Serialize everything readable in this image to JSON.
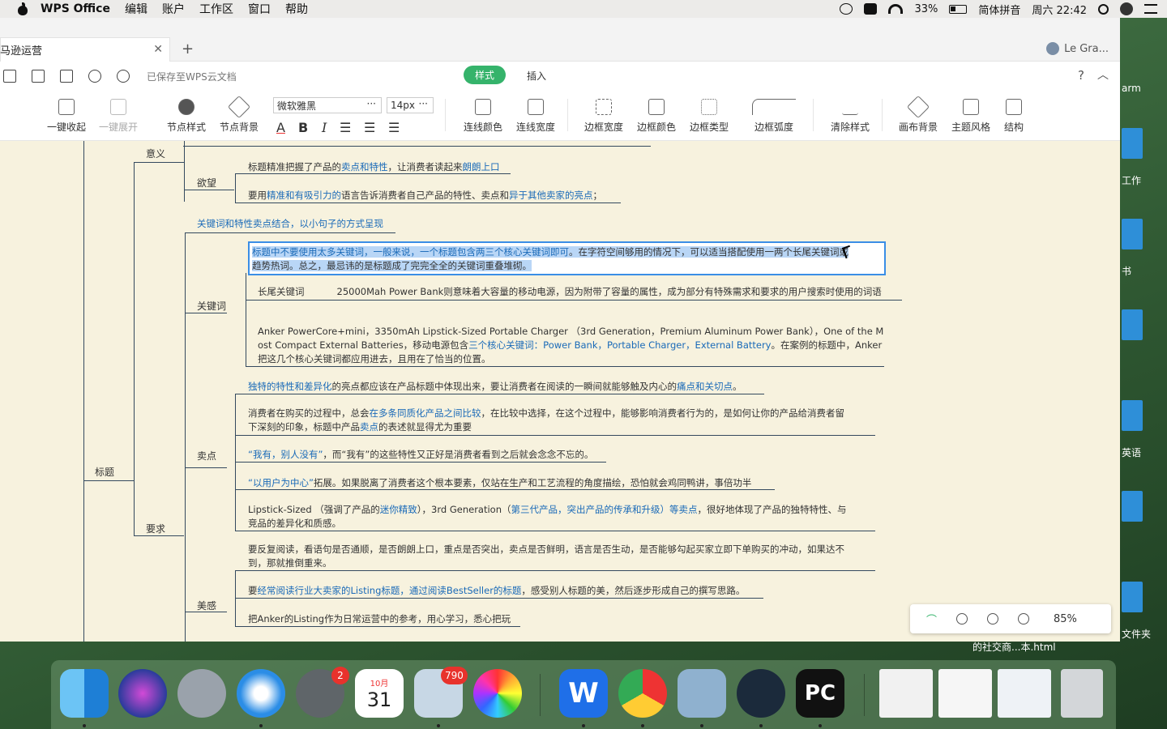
{
  "menubar": {
    "app": "WPS Office",
    "items": [
      "编辑",
      "账户",
      "工作区",
      "窗口",
      "帮助"
    ],
    "battery": "33%",
    "input_method": "简体拼音",
    "clock": "周六 22:42"
  },
  "tab": {
    "title": "亚马逊运营"
  },
  "user": {
    "name": "Le Gra..."
  },
  "toolbar": {
    "saved": "已保存至WPS云文档",
    "style_tab": "样式",
    "insert_tab": "插入",
    "help": "?",
    "buttons": {
      "collapse_all": "一键收起",
      "expand_all": "一键展开",
      "node_style": "节点样式",
      "node_bg": "节点背景",
      "line_color": "连线颜色",
      "line_width": "连线宽度",
      "border_width": "边框宽度",
      "border_color": "边框颜色",
      "border_type": "边框类型",
      "border_radius": "边框弧度",
      "clear_style": "清除样式",
      "canvas_bg": "画布背景",
      "theme": "主题风格",
      "structure": "结构"
    },
    "font": "微软雅黑",
    "font_size": "14px"
  },
  "mindmap": {
    "root": "标题",
    "b_meaning": "意义",
    "b_desire": "欲望",
    "desire_1_a": "标题精准把握了产品的",
    "desire_1_b": "卖点和特性",
    "desire_1_c": "，让消费者读起来",
    "desire_1_d": "朗朗上口",
    "desire_2_a": "要用",
    "desire_2_b": "精准和有吸引力的",
    "desire_2_c": "语言告诉消费者自己产品的特性、卖点和",
    "desire_2_d": "异于其他卖家的亮点",
    "desire_2_e": "；",
    "b_require": "要求",
    "kw_title": "关键词和特性卖点结合，以小句子的方式呈现",
    "b_keyword": "关键词",
    "kw_sel_1a": "标题中不要使用太多关键词，一般来说，一个标题包含两三个核心关键词即可",
    "kw_sel_1b": "。在字符空间够用的情况下，可以适当搭配使用一两个长尾关键词或",
    "kw_sel_2": "趋势热词。总之，最忌讳的是标题成了完完全全的关键词重叠堆砌。",
    "kw_longtail_label": "长尾关键词",
    "kw_longtail_text": "25000Mah Power Bank则意味着大容量的移动电源，因为附带了容量的属性，成为部分有特殊需求和要求的用户搜索时使用的词语",
    "kw_anker_1": "Anker PowerCore+mini，3350mAh Lipstick-Sized Portable Charger （3rd Generation，Premium Aluminum Power Bank），One of the M",
    "kw_anker_2a": "ost Compact External Batteries，移动电源包含",
    "kw_anker_2b": "三个核心关键词：Power Bank，Portable Charger，External Battery",
    "kw_anker_2c": "。在案例的标题中，Anker",
    "kw_anker_3": "把这几个核心关键词都应用进去，且用在了恰当的位置。",
    "b_selling": "卖点",
    "sp_title_a": "独特的特性和差异化",
    "sp_title_b": "的亮点都应该在产品标题中体现出来，要让消费者在阅读的一瞬间就能够触及内心的",
    "sp_title_c": "痛点和关切点",
    "sp_title_d": "。",
    "sp_1a": "消费者在购买的过程中，总会",
    "sp_1b": "在多条同质化产品之间比较",
    "sp_1c": "，在比较中选择，在这个过程中，能够影响消费者行为的，是如何让你的产品给消费者留",
    "sp_1d": "下深刻的印象，标题中产品",
    "sp_1e": "卖点",
    "sp_1f": "的表述就显得尤为重要",
    "sp_2a": "“我有，别人没有”",
    "sp_2b": "，而“我有”的这些特性又正好是消费者看到之后就会念念不忘的。",
    "sp_3a": "“以用户为中心”",
    "sp_3b": "拓展。如果脱离了消费者这个根本要素，仅站在生产和工艺流程的角度描绘，恐怕就会鸡同鸭讲，事倍功半",
    "sp_4a": "Lipstick-Sized （强调了产品的",
    "sp_4b": "迷你精致",
    "sp_4c": "），3rd Generation（",
    "sp_4d": "第三代产品，突出产品的传承和升级）等卖点",
    "sp_4e": "，很好地体现了产品的独特特性、与",
    "sp_4f": "竞品的差异化和质感。",
    "b_beauty": "美感",
    "be_1a": "要反复阅读，看语句是否通顺，是否朗朗上口，重点是否突出，卖点是否鲜明，语言是否生动，是否能够勾起买家立即下单购买的冲动，如果达不",
    "be_1b": "到，那就推倒重来。",
    "be_2a": "要",
    "be_2b": "经常阅读行业大卖家的Listing标题，通过阅读BestSeller的标题",
    "be_2c": "，感受别人标题的美，然后逐步形成自己的撰写思路。",
    "be_3": "把Anker的Listing作为日常运营中的参考，用心学习，悉心把玩"
  },
  "zoom": {
    "value": "85%"
  },
  "desktop": {
    "labels": [
      "arm",
      "工作",
      "书",
      "英语",
      "文件夹"
    ],
    "filename": "的社交商...本.html"
  },
  "dock": {
    "calendar_month": "10月",
    "calendar_day": "31",
    "badge_settings": "2",
    "badge_mail": "790"
  }
}
